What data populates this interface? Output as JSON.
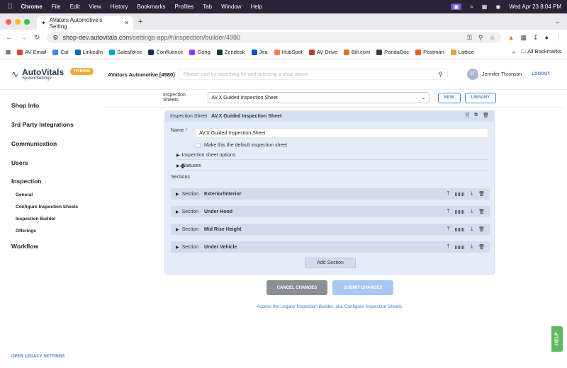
{
  "mac_menu": {
    "app": "Chrome",
    "items": [
      "File",
      "Edit",
      "View",
      "History",
      "Bookmarks",
      "Profiles",
      "Tab",
      "Window",
      "Help"
    ],
    "clock": "Wed Apr 23  8:04 PM"
  },
  "browser": {
    "tab_title": "AVators Automotive's Setting",
    "url_host": "shop-dev.autovitals.com",
    "url_path": "/settings-app/#/inspection/builder/4980",
    "bookmarks": [
      {
        "label": "AV Email",
        "color": "#d44638"
      },
      {
        "label": "Cal",
        "color": "#4285f4"
      },
      {
        "label": "LinkedIn",
        "color": "#0a66c2"
      },
      {
        "label": "Salesforce",
        "color": "#00a1e0"
      },
      {
        "label": "Confluence",
        "color": "#172b4d"
      },
      {
        "label": "Gong",
        "color": "#8a3ffc"
      },
      {
        "label": "Zendesk",
        "color": "#03363d"
      },
      {
        "label": "Jira",
        "color": "#0052cc"
      },
      {
        "label": "HubSpot",
        "color": "#ff7a59"
      },
      {
        "label": "AV Drive",
        "color": "#c0392b"
      },
      {
        "label": "Bill.com",
        "color": "#e8731f"
      },
      {
        "label": "PandaDoc",
        "color": "#3a3a3a"
      },
      {
        "label": "Postman",
        "color": "#ef5b25"
      },
      {
        "label": "Lattice",
        "color": "#d9a23b"
      }
    ],
    "all_bookmarks": "All Bookmarks"
  },
  "header": {
    "logo_main": "AutoVitals",
    "logo_sub": "SystemSettings",
    "badge": "HYBRID",
    "shop_name": "AVators Automotive [4980]",
    "search_placeholder": "Please start by searching for and selecting a shop above",
    "user_initials": "JT",
    "user_name": "Jennifer Thronson",
    "logout": "LOGOUT"
  },
  "sidebar": {
    "items": [
      "Shop Info",
      "3rd Party Integrations",
      "Communication",
      "Users",
      "Inspection",
      "Workflow"
    ],
    "sub_items": [
      "General",
      "Configure Inspection Sheets",
      "Inspection Builder",
      "Offerings"
    ],
    "legacy": "OPEN LEGACY SETTINGS"
  },
  "main": {
    "selector_label": "Inspection Sheets",
    "selected_sheet": "AV.X Guided Inspection Sheet",
    "new_btn": "NEW",
    "library_btn": "LIBRARY",
    "panel_label": "Inspection Sheet",
    "panel_title": "AV.X Guided Inspection Sheet",
    "name_label": "Name",
    "name_value": "AV.X Guided Inspection Sheet",
    "default_label": "Make this the default inspection sheet",
    "options_label": "Inspection sheet options",
    "statuses_label": "Statuses",
    "sections_label": "Sections",
    "section_word": "Section",
    "sections": [
      "Exterior/Interior",
      "Under Hood",
      "Mid Rise Height",
      "Under Vehicle"
    ],
    "add_section": "Add Section",
    "cancel": "CANCEL CHANGES",
    "submit": "SUBMIT CHANGES",
    "legacy_link": "Access the Legacy Inspection Builder, aka Configure Inspection Sheets"
  },
  "help": "HELP"
}
